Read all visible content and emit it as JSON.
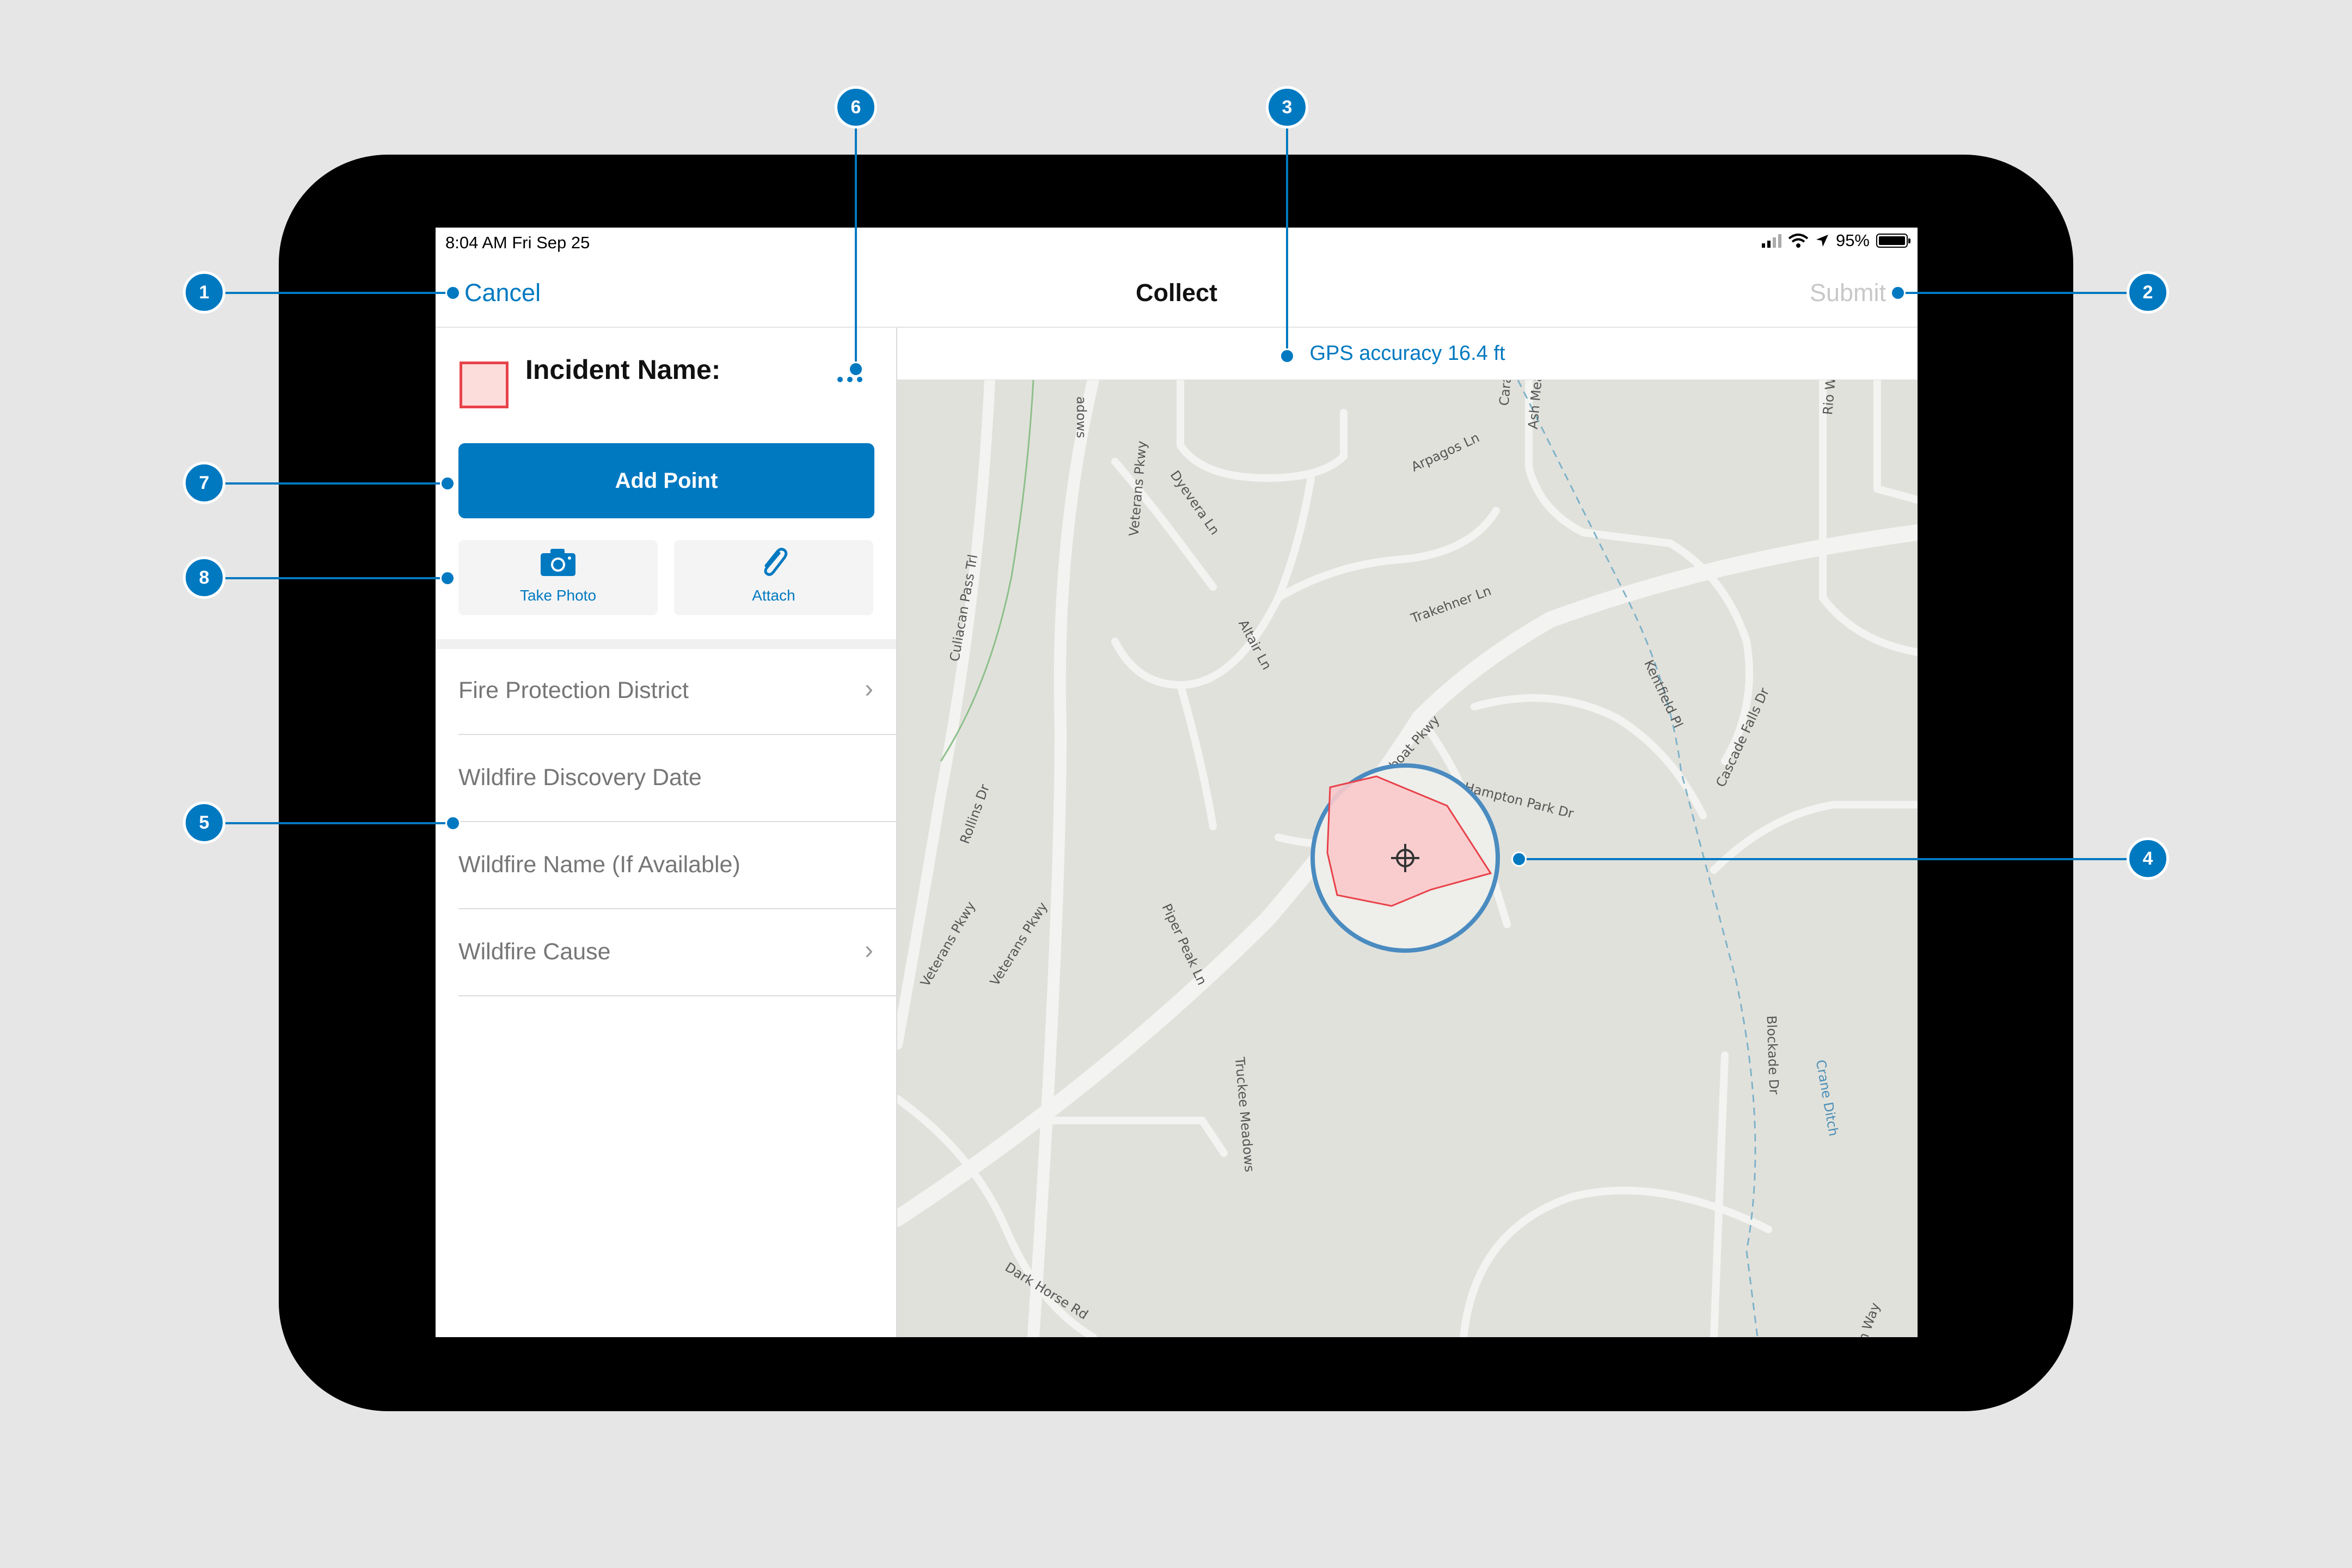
{
  "status_bar": {
    "time": "8:04 AM   Fri Sep 25",
    "battery": "95%"
  },
  "nav": {
    "cancel": "Cancel",
    "title": "Collect",
    "submit": "Submit"
  },
  "form": {
    "title": "Incident Name:",
    "add_point": "Add Point",
    "take_photo": "Take Photo",
    "attach": "Attach",
    "fields": [
      {
        "label": "Fire Protection District"
      },
      {
        "label": "Wildfire Discovery Date"
      },
      {
        "label": "Wildfire Name (If Available)"
      },
      {
        "label": "Wildfire Cause"
      }
    ]
  },
  "map": {
    "gps_accuracy": "GPS accuracy 16.4 ft",
    "streets": [
      "adows",
      "Veterans Pkwy",
      "Dyevera Ln",
      "Arpagos Ln",
      "Trakehner Ln",
      "Altair Ln",
      "Culiacan Pass Trl",
      "Rollins Dr",
      "Veterans Pkwy",
      "Veterans Pkwy",
      "Steamboat Pkwy",
      "Hampton Park Dr",
      "Piper Peak Ln",
      "Truckee Meadows",
      "Kentfield Pl",
      "Cascade Falls Dr",
      "Blockade Dr",
      "Crane Ditch",
      "Dark Horse Rd",
      "Ash Mea",
      "Cara",
      "Rio W",
      "an Way"
    ]
  },
  "callouts": [
    "1",
    "2",
    "3",
    "4",
    "5",
    "6",
    "7",
    "8"
  ],
  "colors": {
    "accent": "#0079c1",
    "polygon_fill": "#fddcdc",
    "polygon_stroke": "#e8424a"
  }
}
